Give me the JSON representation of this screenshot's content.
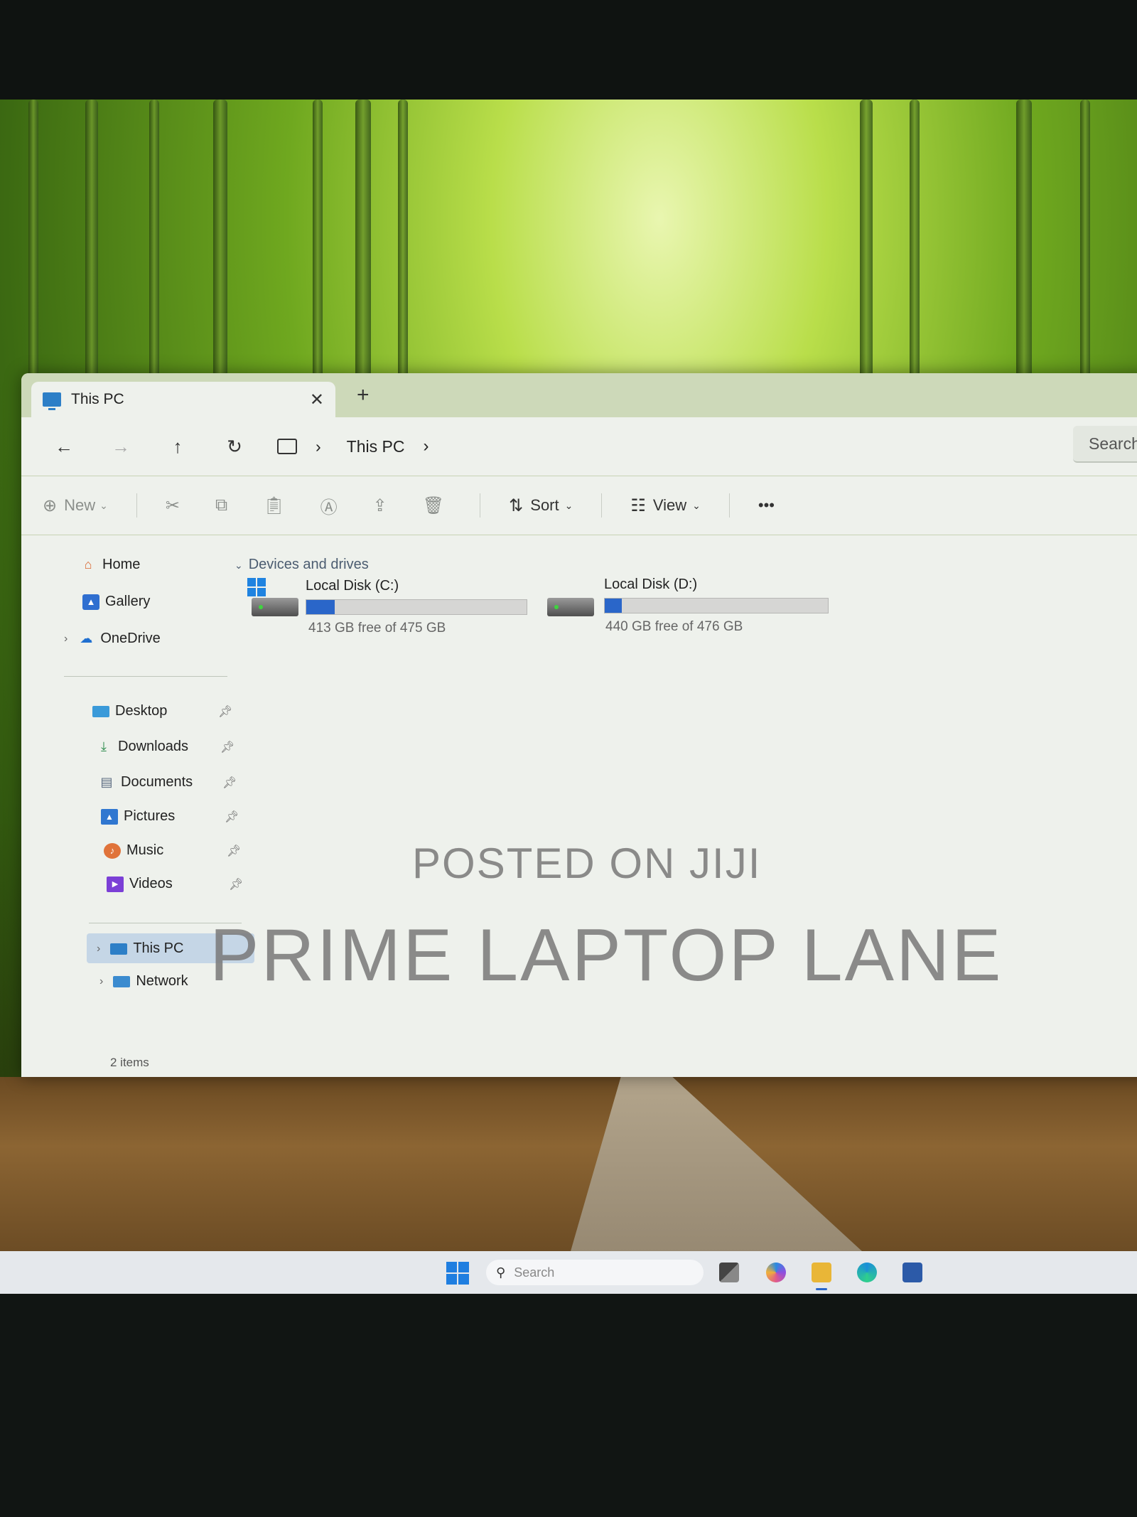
{
  "window": {
    "tab_title": "This PC",
    "tab_close": "✕",
    "new_tab": "+"
  },
  "navigation": {
    "back": "←",
    "forward": "→",
    "up": "↑",
    "refresh": "↻",
    "path_sep": "›",
    "breadcrumb": [
      "This PC"
    ],
    "search_placeholder": "Search"
  },
  "toolbar": {
    "new_label": "New",
    "sort_label": "Sort",
    "view_label": "View",
    "more_label": "•••",
    "icons": [
      "cut-icon",
      "copy-icon",
      "paste-icon",
      "rename-icon",
      "share-icon",
      "delete-icon"
    ]
  },
  "sidebar": {
    "top": [
      {
        "label": "Home",
        "icon": "home-icon"
      },
      {
        "label": "Gallery",
        "icon": "gallery-icon"
      },
      {
        "label": "OneDrive",
        "icon": "onedrive-icon"
      }
    ],
    "pinned": [
      {
        "label": "Desktop",
        "icon": "desktop-icon"
      },
      {
        "label": "Downloads",
        "icon": "downloads-icon"
      },
      {
        "label": "Documents",
        "icon": "documents-icon"
      },
      {
        "label": "Pictures",
        "icon": "pictures-icon"
      },
      {
        "label": "Music",
        "icon": "music-icon"
      },
      {
        "label": "Videos",
        "icon": "videos-icon"
      }
    ],
    "locations": [
      {
        "label": "This PC",
        "icon": "this-pc-icon",
        "selected": true
      },
      {
        "label": "Network",
        "icon": "network-icon"
      }
    ]
  },
  "main": {
    "section_title": "Devices and drives",
    "drives": [
      {
        "name": "Local Disk (C:)",
        "free_text": "413 GB free of 475 GB",
        "used_fraction": 0.13
      },
      {
        "name": "Local Disk (D:)",
        "free_text": "440 GB free of 476 GB",
        "used_fraction": 0.076
      }
    ]
  },
  "status_bar": {
    "item_count": "2 items"
  },
  "watermark": {
    "line1": "POSTED ON JIJI",
    "line2": "PRIME LAPTOP LANE"
  },
  "taskbar": {
    "search_placeholder": "Search",
    "apps": [
      "task-view-icon",
      "copilot-icon",
      "file-explorer-icon",
      "edge-icon",
      "store-icon"
    ]
  },
  "colors": {
    "accent": "#2a66c9",
    "selection": "#c5d6e6"
  }
}
